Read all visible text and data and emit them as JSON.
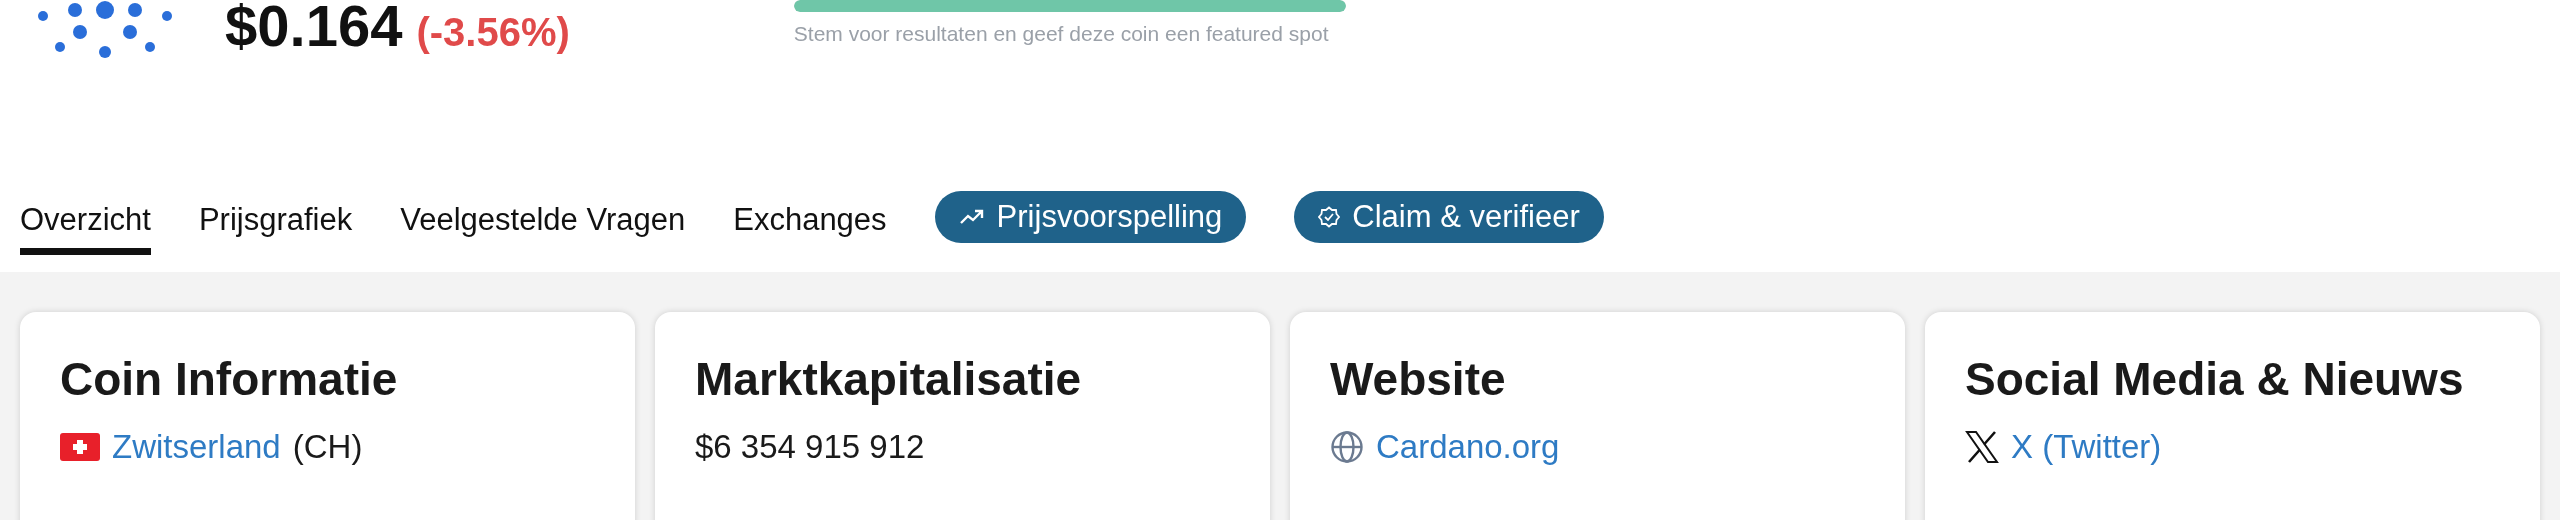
{
  "coin": {
    "price": "$0.164",
    "change": "(-3.56%)"
  },
  "vote": {
    "level": 1,
    "caption": "Stem voor resultaten en geef deze coin een featured spot"
  },
  "tabs": [
    {
      "label": "Overzicht",
      "kind": "tab",
      "selected": true
    },
    {
      "label": "Prijsgrafiek",
      "kind": "tab",
      "selected": false
    },
    {
      "label": "Veelgestelde Vragen",
      "kind": "tab",
      "selected": false
    },
    {
      "label": "Exchanges",
      "kind": "tab",
      "selected": false
    },
    {
      "label": "Prijsvoorspelling",
      "kind": "pill",
      "selected": false
    },
    {
      "label": "Claim & verifieer",
      "kind": "pill",
      "selected": false
    }
  ],
  "cards": [
    {
      "title": "Coin Informatie",
      "items": [
        {
          "link": "Zwitserland",
          "text": "(CH)"
        }
      ]
    },
    {
      "title": "Marktkapitalisatie",
      "items": [
        {
          "text": "$6 354 915 912"
        }
      ]
    },
    {
      "title": "Website",
      "items": [
        {
          "link": "Cardano.org"
        }
      ]
    },
    {
      "title": "Social Media & Nieuws",
      "items": [
        {
          "link": "X (Twitter)"
        }
      ]
    }
  ]
}
